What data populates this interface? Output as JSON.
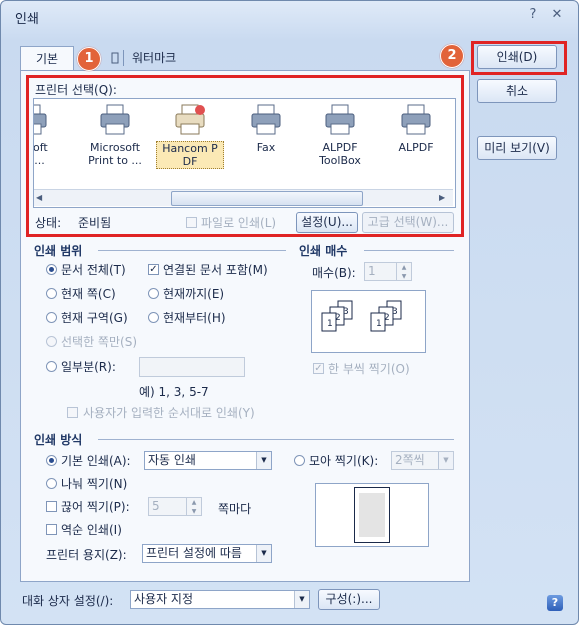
{
  "window": {
    "title": "인쇄",
    "help_symbol": "?",
    "close_symbol": "✕"
  },
  "tabs": {
    "basic": "기본",
    "watermark": "워터마크"
  },
  "badges": {
    "one": "1",
    "two": "2"
  },
  "printer_select": {
    "label": "프린터 선택(Q):",
    "printers": [
      {
        "name": "rosoft\nDo..."
      },
      {
        "name": "Microsoft\nPrint to ..."
      },
      {
        "name": "Hancom P\nDF"
      },
      {
        "name": "Fax"
      },
      {
        "name": "ALPDF\nToolBox"
      },
      {
        "name": "ALPDF"
      }
    ],
    "selected": "Hancom PDF",
    "status_label": "상태:",
    "status_value": "준비됨",
    "print_to_file": "파일로 인쇄(L)",
    "settings_button": "설정(U)...",
    "advanced_button": "고급 선택(W)..."
  },
  "range": {
    "legend": "인쇄 범위",
    "all_doc": "문서 전체(T)",
    "linked_docs": "연결된 문서 포함(M)",
    "current_page": "현재 쪽(C)",
    "to_current": "현재까지(E)",
    "current_section": "현재 구역(G)",
    "from_current": "현재부터(H)",
    "selected_pages": "선택한 쪽만(S)",
    "partial": "일부분(R):",
    "example": "예) 1, 3, 5-7",
    "user_order": "사용자가 입력한 순서대로 인쇄(Y)"
  },
  "copies": {
    "legend": "인쇄 매수",
    "label": "매수(B):",
    "value": "1",
    "collate": "한 부씩 찍기(O)"
  },
  "method": {
    "legend": "인쇄 방식",
    "basic_print": "기본 인쇄(A):",
    "basic_value": "자동 인쇄",
    "split_print": "나눠 찍기(N)",
    "cut_print": "끊어 찍기(P):",
    "cut_value": "5",
    "cut_suffix": "쪽마다",
    "reverse_print": "역순 인쇄(I)",
    "paper_label": "프린터 용지(Z):",
    "paper_value": "프린터 설정에 따름",
    "gather_print": "모아 찍기(K):",
    "gather_value": "2쪽씩"
  },
  "side_buttons": {
    "print": "인쇄(D)",
    "cancel": "취소",
    "preview": "미리 보기(V)"
  },
  "bottom": {
    "label": "대화 상자 설정(/):",
    "value": "사용자 지정",
    "compose": "구성(:)...",
    "help": "?"
  },
  "colors": {
    "highlight": "#e02424",
    "badge": "#e2633a"
  }
}
